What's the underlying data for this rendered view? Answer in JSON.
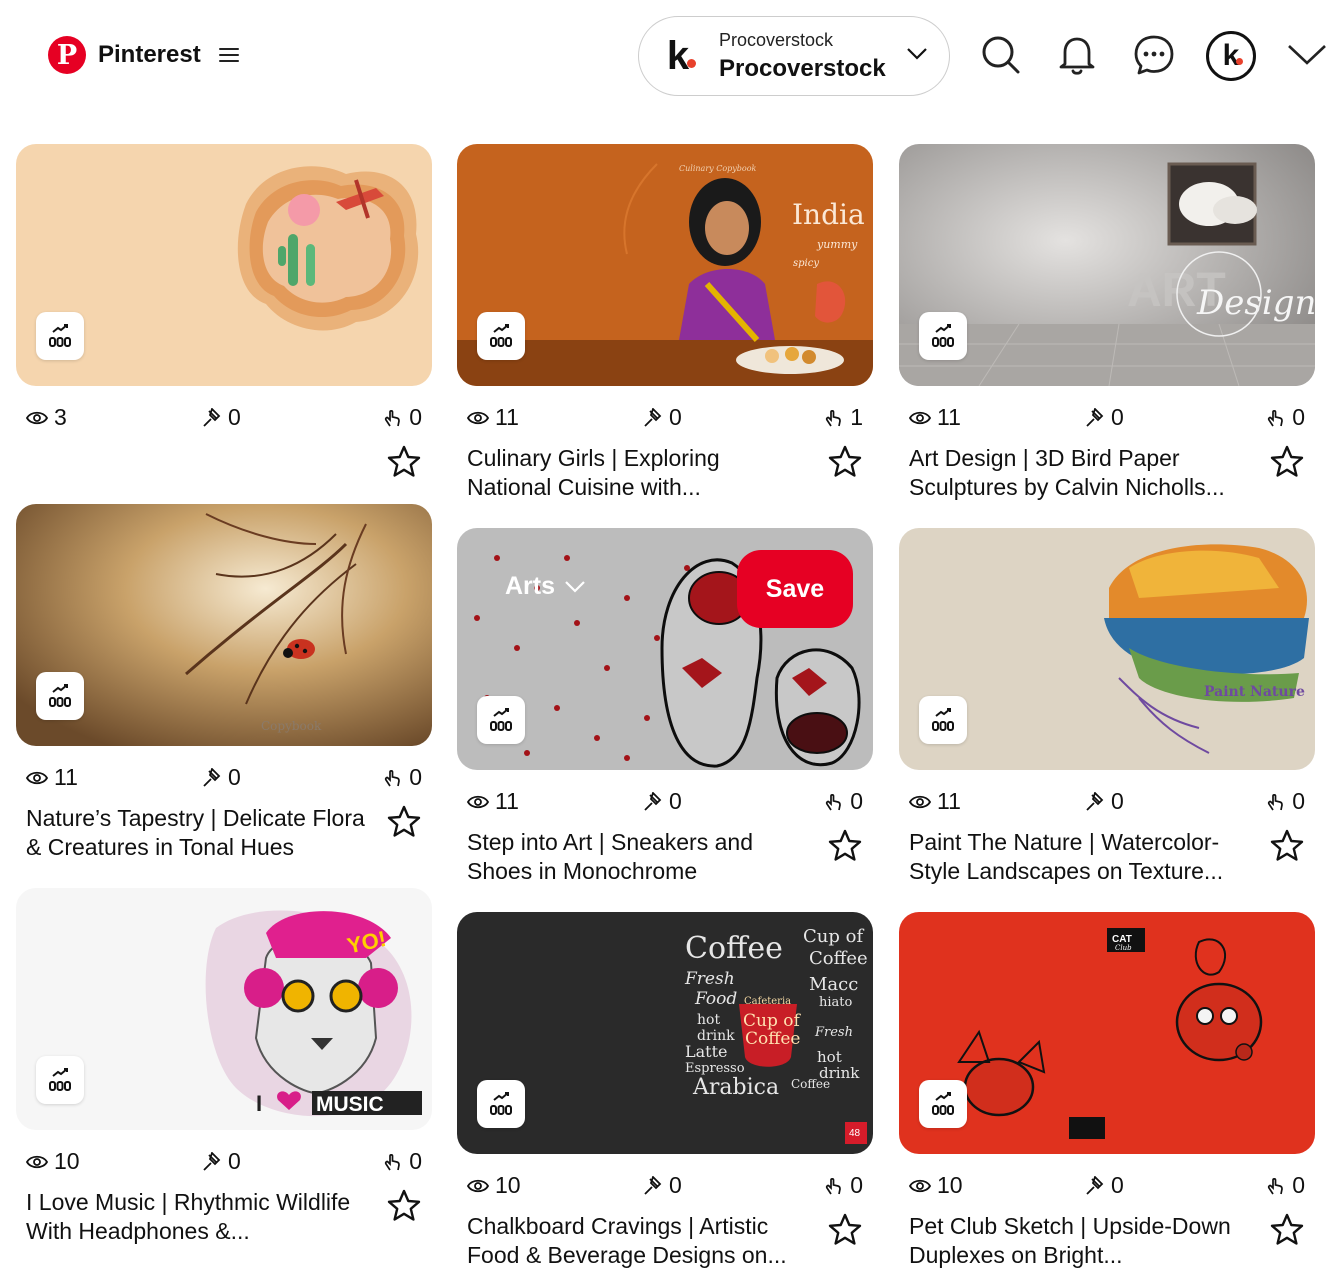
{
  "header": {
    "brand": "Pinterest",
    "account": {
      "subtitle": "Procoverstock",
      "name": "Procoverstock",
      "avatar_letter": "k"
    }
  },
  "colors": {
    "brand_red": "#e60023",
    "avatar_dot": "#e8412c"
  },
  "pins": [
    {
      "views": "3",
      "saves": "0",
      "clicks": "0",
      "title": ""
    },
    {
      "views": "11",
      "saves": "0",
      "clicks": "1",
      "title": "Culinary Girls | Exploring National Cuisine with...",
      "image_text": {
        "top": "Culinary Copybook",
        "word": "India",
        "sub": "yummy",
        "spicy": "spicy",
        "spice": "spicy"
      }
    },
    {
      "views": "11",
      "saves": "0",
      "clicks": "0",
      "title": "Art Design | 3D Bird Paper Sculptures by Calvin Nicholls...",
      "image_text": {
        "art": "ART",
        "design": "Design"
      }
    },
    {
      "views": "11",
      "saves": "0",
      "clicks": "0",
      "title": "Nature’s Tapestry | Delicate Flora & Creatures in Tonal Hues",
      "image_text": {
        "mark": "Copybook"
      }
    },
    {
      "views": "11",
      "saves": "0",
      "clicks": "0",
      "title": "Step into Art | Sneakers and Shoes in Monochrome",
      "hover": {
        "board": "Arts",
        "save": "Save"
      }
    },
    {
      "views": "11",
      "saves": "0",
      "clicks": "0",
      "title": "Paint The Nature | Watercolor-Style Landscapes on Texture...",
      "image_text": {
        "label": "Paint Nature"
      }
    },
    {
      "views": "10",
      "saves": "0",
      "clicks": "0",
      "title": "I Love Music | Rhythmic Wildlife With Headphones &...",
      "image_text": {
        "yo": "YO!",
        "i": "I",
        "music": "MUSIC"
      }
    },
    {
      "views": "10",
      "saves": "0",
      "clicks": "0",
      "title": "Chalkboard Cravings | Artistic Food & Beverage Designs on...",
      "image_text": {
        "coffee": "Coffee",
        "cup": "Cup of",
        "cup2": "Coffee",
        "fresh": "Fresh",
        "food": "Food",
        "cafeteria": "Cafeteria",
        "cupof": "Cup of",
        "coffee3": "Coffee",
        "macc": "Macc",
        "hiato": "hiato",
        "hot": "hot",
        "drink": "drink",
        "latte": "Latte",
        "espresso": "Espresso",
        "arabica": "Arabica",
        "beans": "Coffee",
        "sheets": "48"
      }
    },
    {
      "views": "10",
      "saves": "0",
      "clicks": "0",
      "title": "Pet Club Sketch | Upside-Down Duplexes on Bright...",
      "image_text": {
        "cat": "CAT",
        "club": "Club"
      }
    }
  ]
}
